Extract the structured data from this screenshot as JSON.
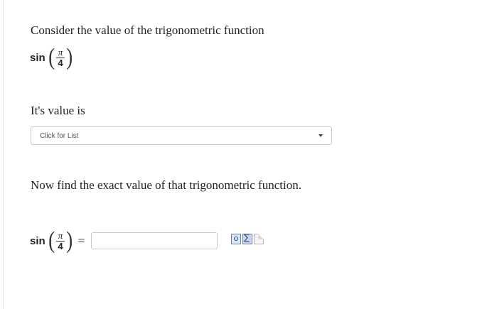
{
  "question": {
    "intro": "Consider the value of the trigonometric function",
    "expression": {
      "function": "sin",
      "numerator": "π",
      "denominator": "4"
    },
    "value_label": "It's value is",
    "value_select": {
      "selected": "Click for List"
    },
    "exact_prompt": "Now find the exact value of that trigonometric function.",
    "equation": {
      "function": "sin",
      "numerator": "π",
      "denominator": "4",
      "equals": "=",
      "answer_value": ""
    }
  },
  "tools": {
    "icons": [
      "preview-icon",
      "equation-editor-icon",
      "blank-page-icon"
    ]
  }
}
